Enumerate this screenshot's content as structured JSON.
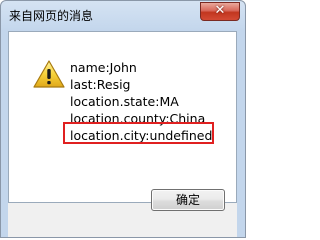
{
  "window": {
    "title": "来自网页的消息",
    "close_icon": "close-icon"
  },
  "message": {
    "icon": "warning-icon",
    "lines": [
      "name:John",
      "last:Resig",
      "location.state:MA",
      "location.county:China",
      "location.city:undefined"
    ],
    "highlighted_line_index": 4,
    "highlight_color": "#e02020"
  },
  "buttons": {
    "ok_label": "确定"
  },
  "colors": {
    "titlebar": "#c3d6ec",
    "close_button": "#c2361f"
  }
}
